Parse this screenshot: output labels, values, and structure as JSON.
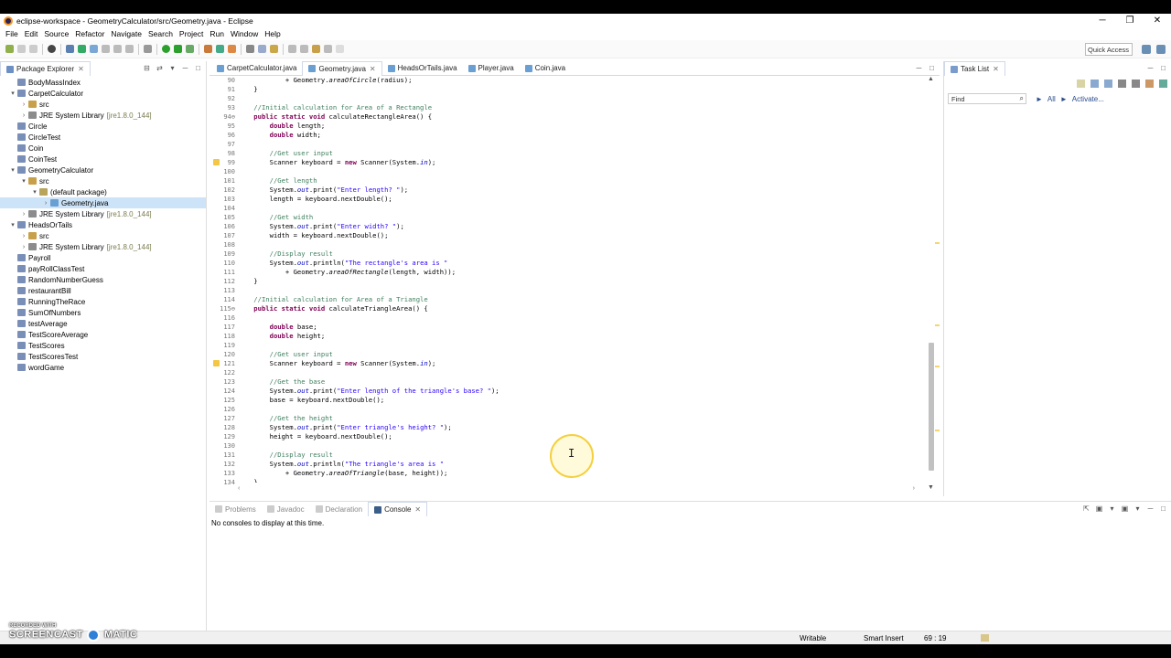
{
  "window": {
    "title": "eclipse-workspace - GeometryCalculator/src/Geometry.java - Eclipse",
    "minimize": "─",
    "maximize": "❐",
    "close": "✕"
  },
  "menu": [
    "File",
    "Edit",
    "Source",
    "Refactor",
    "Navigate",
    "Search",
    "Project",
    "Run",
    "Window",
    "Help"
  ],
  "toolbar": {
    "quick_access": "Quick Access"
  },
  "package_explorer": {
    "title": "Package Explorer",
    "nodes": [
      {
        "label": "BodyMassIndex",
        "indent": 0,
        "arrow": "",
        "icon": "project"
      },
      {
        "label": "CarpetCalculator",
        "indent": 0,
        "arrow": "▾",
        "icon": "project"
      },
      {
        "label": "src",
        "indent": 1,
        "arrow": "›",
        "icon": "src"
      },
      {
        "label": "JRE System Library",
        "extra": "[jre1.8.0_144]",
        "indent": 1,
        "arrow": "›",
        "icon": "lib"
      },
      {
        "label": "Circle",
        "indent": 0,
        "arrow": "",
        "icon": "project"
      },
      {
        "label": "CircleTest",
        "indent": 0,
        "arrow": "",
        "icon": "project"
      },
      {
        "label": "Coin",
        "indent": 0,
        "arrow": "",
        "icon": "project"
      },
      {
        "label": "CoinTest",
        "indent": 0,
        "arrow": "",
        "icon": "project"
      },
      {
        "label": "GeometryCalculator",
        "indent": 0,
        "arrow": "▾",
        "icon": "project"
      },
      {
        "label": "src",
        "indent": 1,
        "arrow": "▾",
        "icon": "src"
      },
      {
        "label": "(default package)",
        "indent": 2,
        "arrow": "▾",
        "icon": "pkg"
      },
      {
        "label": "Geometry.java",
        "indent": 3,
        "arrow": "›",
        "icon": "java",
        "selected": true
      },
      {
        "label": "JRE System Library",
        "extra": "[jre1.8.0_144]",
        "indent": 1,
        "arrow": "›",
        "icon": "lib"
      },
      {
        "label": "HeadsOrTails",
        "indent": 0,
        "arrow": "▾",
        "icon": "project"
      },
      {
        "label": "src",
        "indent": 1,
        "arrow": "›",
        "icon": "src"
      },
      {
        "label": "JRE System Library",
        "extra": "[jre1.8.0_144]",
        "indent": 1,
        "arrow": "›",
        "icon": "lib"
      },
      {
        "label": "Payroll",
        "indent": 0,
        "arrow": "",
        "icon": "project"
      },
      {
        "label": "payRollClassTest",
        "indent": 0,
        "arrow": "",
        "icon": "project"
      },
      {
        "label": "RandomNumberGuess",
        "indent": 0,
        "arrow": "",
        "icon": "project"
      },
      {
        "label": "restaurantBill",
        "indent": 0,
        "arrow": "",
        "icon": "project"
      },
      {
        "label": "RunningTheRace",
        "indent": 0,
        "arrow": "",
        "icon": "project"
      },
      {
        "label": "SumOfNumbers",
        "indent": 0,
        "arrow": "",
        "icon": "project"
      },
      {
        "label": "testAverage",
        "indent": 0,
        "arrow": "",
        "icon": "project"
      },
      {
        "label": "TestScoreAverage",
        "indent": 0,
        "arrow": "",
        "icon": "project"
      },
      {
        "label": "TestScores",
        "indent": 0,
        "arrow": "",
        "icon": "project"
      },
      {
        "label": "TestScoresTest",
        "indent": 0,
        "arrow": "",
        "icon": "project"
      },
      {
        "label": "wordGame",
        "indent": 0,
        "arrow": "",
        "icon": "project"
      }
    ]
  },
  "editor": {
    "tabs": [
      {
        "label": "CarpetCalculator.java",
        "active": false
      },
      {
        "label": "Geometry.java",
        "active": true
      },
      {
        "label": "HeadsOrTails.java",
        "active": false
      },
      {
        "label": "Player.java",
        "active": false
      },
      {
        "label": "Coin.java",
        "active": false
      }
    ],
    "lines": [
      {
        "n": "90",
        "tokens": [
          [
            "",
            "            + Geometry."
          ],
          [
            "it",
            "areaOfCircle"
          ],
          [
            "",
            "(radius);"
          ]
        ]
      },
      {
        "n": "91",
        "tokens": [
          [
            "",
            "    }"
          ]
        ]
      },
      {
        "n": "92",
        "tokens": []
      },
      {
        "n": "93",
        "tokens": [
          [
            "cm",
            "    //Initial calculation for Area of a Rectangle"
          ]
        ]
      },
      {
        "n": "94⊖",
        "tokens": [
          [
            "kw",
            "    public static void "
          ],
          [
            "",
            "calculateRectangleArea() {"
          ]
        ]
      },
      {
        "n": "95",
        "tokens": [
          [
            "kw",
            "        double "
          ],
          [
            "",
            "length;"
          ]
        ]
      },
      {
        "n": "96",
        "tokens": [
          [
            "kw",
            "        double "
          ],
          [
            "",
            "width;"
          ]
        ]
      },
      {
        "n": "97",
        "tokens": []
      },
      {
        "n": "98",
        "tokens": [
          [
            "cm",
            "        //Get user input"
          ]
        ]
      },
      {
        "n": "99",
        "warn": true,
        "tokens": [
          [
            "",
            "        Scanner keyboard = "
          ],
          [
            "kw",
            "new "
          ],
          [
            "",
            "Scanner(System."
          ],
          [
            "fld",
            "in"
          ],
          [
            "",
            ");"
          ]
        ]
      },
      {
        "n": "100",
        "tokens": []
      },
      {
        "n": "101",
        "tokens": [
          [
            "cm",
            "        //Get length"
          ]
        ]
      },
      {
        "n": "102",
        "tokens": [
          [
            "",
            "        System."
          ],
          [
            "fld",
            "out"
          ],
          [
            "",
            ".print("
          ],
          [
            "st",
            "\"Enter length? \""
          ],
          [
            "",
            ");"
          ]
        ]
      },
      {
        "n": "103",
        "tokens": [
          [
            "",
            "        length = keyboard.nextDouble();"
          ]
        ]
      },
      {
        "n": "104",
        "tokens": []
      },
      {
        "n": "105",
        "tokens": [
          [
            "cm",
            "        //Get width"
          ]
        ]
      },
      {
        "n": "106",
        "tokens": [
          [
            "",
            "        System."
          ],
          [
            "fld",
            "out"
          ],
          [
            "",
            ".print("
          ],
          [
            "st",
            "\"Enter width? \""
          ],
          [
            "",
            ");"
          ]
        ]
      },
      {
        "n": "107",
        "tokens": [
          [
            "",
            "        width = keyboard.nextDouble();"
          ]
        ]
      },
      {
        "n": "108",
        "tokens": []
      },
      {
        "n": "109",
        "tokens": [
          [
            "cm",
            "        //Display result"
          ]
        ]
      },
      {
        "n": "110",
        "tokens": [
          [
            "",
            "        System."
          ],
          [
            "fld",
            "out"
          ],
          [
            "",
            ".println("
          ],
          [
            "st",
            "\"The rectangle's area is \""
          ]
        ]
      },
      {
        "n": "111",
        "tokens": [
          [
            "",
            "            + Geometry."
          ],
          [
            "it",
            "areaOfRectangle"
          ],
          [
            "",
            "(length, width));"
          ]
        ]
      },
      {
        "n": "112",
        "tokens": [
          [
            "",
            "    }"
          ]
        ]
      },
      {
        "n": "113",
        "tokens": []
      },
      {
        "n": "114",
        "tokens": [
          [
            "cm",
            "    //Initial calculation for Area of a Triangle"
          ]
        ]
      },
      {
        "n": "115⊖",
        "tokens": [
          [
            "kw",
            "    public static void "
          ],
          [
            "",
            "calculateTriangleArea() {"
          ]
        ]
      },
      {
        "n": "116",
        "tokens": []
      },
      {
        "n": "117",
        "tokens": [
          [
            "kw",
            "        double "
          ],
          [
            "",
            "base;"
          ]
        ]
      },
      {
        "n": "118",
        "tokens": [
          [
            "kw",
            "        double "
          ],
          [
            "",
            "height;"
          ]
        ]
      },
      {
        "n": "119",
        "tokens": []
      },
      {
        "n": "120",
        "tokens": [
          [
            "cm",
            "        //Get user input"
          ]
        ]
      },
      {
        "n": "121",
        "warn": true,
        "tokens": [
          [
            "",
            "        Scanner keyboard = "
          ],
          [
            "kw",
            "new "
          ],
          [
            "",
            "Scanner(System."
          ],
          [
            "fld",
            "in"
          ],
          [
            "",
            ");"
          ]
        ]
      },
      {
        "n": "122",
        "tokens": []
      },
      {
        "n": "123",
        "tokens": [
          [
            "cm",
            "        //Get the base"
          ]
        ]
      },
      {
        "n": "124",
        "tokens": [
          [
            "",
            "        System."
          ],
          [
            "fld",
            "out"
          ],
          [
            "",
            ".print("
          ],
          [
            "st",
            "\"Enter length of the triangle's base? \""
          ],
          [
            "",
            ");"
          ]
        ]
      },
      {
        "n": "125",
        "tokens": [
          [
            "",
            "        base = keyboard.nextDouble();"
          ]
        ]
      },
      {
        "n": "126",
        "tokens": []
      },
      {
        "n": "127",
        "tokens": [
          [
            "cm",
            "        //Get the height"
          ]
        ]
      },
      {
        "n": "128",
        "tokens": [
          [
            "",
            "        System."
          ],
          [
            "fld",
            "out"
          ],
          [
            "",
            ".print("
          ],
          [
            "st",
            "\"Enter triangle's height? \""
          ],
          [
            "",
            ");"
          ]
        ]
      },
      {
        "n": "129",
        "tokens": [
          [
            "",
            "        height = keyboard.nextDouble();"
          ]
        ]
      },
      {
        "n": "130",
        "tokens": []
      },
      {
        "n": "131",
        "tokens": [
          [
            "cm",
            "        //Display result"
          ]
        ]
      },
      {
        "n": "132",
        "tokens": [
          [
            "",
            "        System."
          ],
          [
            "fld",
            "out"
          ],
          [
            "",
            ".println("
          ],
          [
            "st",
            "\"The triangle's area is \""
          ]
        ]
      },
      {
        "n": "133",
        "tokens": [
          [
            "",
            "            + Geometry."
          ],
          [
            "it",
            "areaOfTriangle"
          ],
          [
            "",
            "(base, height));"
          ]
        ]
      },
      {
        "n": "134",
        "tokens": [
          [
            "",
            "    }"
          ]
        ]
      }
    ]
  },
  "task_list": {
    "title": "Task List",
    "find_placeholder": "Find",
    "all": "All",
    "activate": "Activate..."
  },
  "console": {
    "tabs": [
      {
        "label": "Problems",
        "active": false
      },
      {
        "label": "Javadoc",
        "active": false
      },
      {
        "label": "Declaration",
        "active": false
      },
      {
        "label": "Console",
        "active": true
      }
    ],
    "message": "No consoles to display at this time."
  },
  "status": {
    "writable": "Writable",
    "insert_mode": "Smart Insert",
    "position": "69 : 19"
  },
  "watermark": {
    "line1": "RECORDED WITH",
    "line2": "SCREENCAST",
    "line3": "MATIC"
  },
  "colors": {
    "keyword": "#7f0055",
    "comment": "#3f7f5f",
    "string": "#2a00ff",
    "field": "#0000c0",
    "selection": "#cde3f7"
  }
}
